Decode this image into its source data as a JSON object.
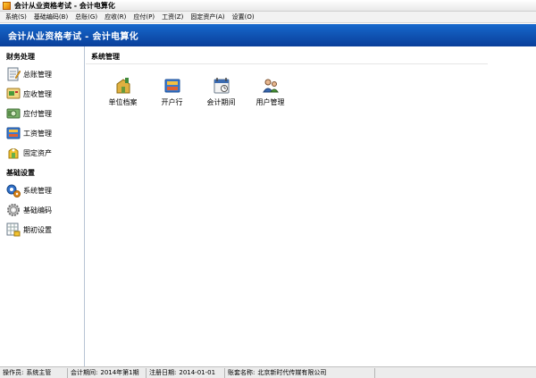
{
  "window": {
    "title": "会计从业资格考试 - 会计电算化"
  },
  "menu": [
    "系统(S)",
    "基础编码(B)",
    "总账(G)",
    "应收(R)",
    "应付(P)",
    "工资(Z)",
    "固定资产(A)",
    "设置(O)"
  ],
  "banner": {
    "title": "会计从业资格考试 - 会计电算化"
  },
  "sidebar": {
    "groups": [
      {
        "title": "财务处理",
        "items": [
          {
            "label": "总账管理",
            "icon": "ledger-icon"
          },
          {
            "label": "应收管理",
            "icon": "receivable-icon"
          },
          {
            "label": "应付管理",
            "icon": "payable-icon"
          },
          {
            "label": "工资管理",
            "icon": "salary-icon"
          },
          {
            "label": "固定资产",
            "icon": "fixed-asset-icon"
          }
        ]
      },
      {
        "title": "基础设置",
        "items": [
          {
            "label": "系统管理",
            "icon": "system-icon"
          },
          {
            "label": "基础编码",
            "icon": "gear-icon"
          },
          {
            "label": "期初设置",
            "icon": "opening-icon"
          }
        ]
      }
    ]
  },
  "main": {
    "section_title": "系统管理",
    "tiles": [
      {
        "label": "单位档案",
        "icon": "company-file-icon"
      },
      {
        "label": "开户行",
        "icon": "bank-icon"
      },
      {
        "label": "会计期间",
        "icon": "calendar-icon"
      },
      {
        "label": "用户管理",
        "icon": "users-icon"
      }
    ]
  },
  "status": {
    "operator_label": "操作员:",
    "operator": "系统主管",
    "period_label": "会计期间:",
    "period": "2014年第1期",
    "date_label": "注册日期:",
    "date": "2014-01-01",
    "account_label": "账套名称:",
    "account": "北京新时代传媒有限公司"
  }
}
